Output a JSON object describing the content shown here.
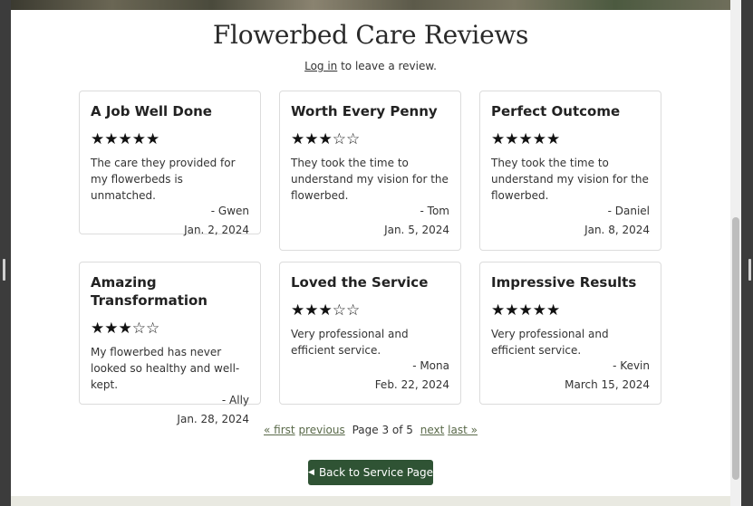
{
  "page": {
    "title": "Flowerbed Care Reviews",
    "login_link": "Log in",
    "login_suffix": " to leave a review."
  },
  "reviews": [
    {
      "title": "A Job Well Done",
      "rating": 5,
      "stars": "★★★★★",
      "text": "The care they provided for my flowerbeds is unmatched.",
      "author": "- Gwen",
      "date": "Jan. 2, 2024"
    },
    {
      "title": "Worth Every Penny",
      "rating": 3,
      "stars": "★★★☆☆",
      "text": "They took the time to understand my vision for the flowerbed.",
      "author": "- Tom",
      "date": "Jan. 5, 2024"
    },
    {
      "title": "Perfect Outcome",
      "rating": 5,
      "stars": "★★★★★",
      "text": "They took the time to understand my vision for the flowerbed.",
      "author": "- Daniel",
      "date": "Jan. 8, 2024"
    },
    {
      "title": "Amazing Transformation",
      "rating": 3,
      "stars": "★★★☆☆",
      "text": "My flowerbed has never looked so healthy and well-kept.",
      "author": "- Ally",
      "date": "Jan. 28, 2024"
    },
    {
      "title": "Loved the Service",
      "rating": 3,
      "stars": "★★★☆☆",
      "text": "Very professional and efficient service.",
      "author": "- Mona",
      "date": "Feb. 22, 2024"
    },
    {
      "title": "Impressive Results",
      "rating": 5,
      "stars": "★★★★★",
      "text": "Very professional and efficient service.",
      "author": "- Kevin",
      "date": "March 15, 2024"
    }
  ],
  "pagination": {
    "first": "« first",
    "previous": "previous",
    "status": "Page 3 of 5",
    "next": "next",
    "last": "last »",
    "current_page": 3,
    "total_pages": 5
  },
  "back_button": {
    "label": "Back to Service Page",
    "icon": "caret-left-icon"
  },
  "colors": {
    "button_bg": "#2f5334",
    "link": "#5a6a4a",
    "card_border": "#dcdcdc"
  }
}
